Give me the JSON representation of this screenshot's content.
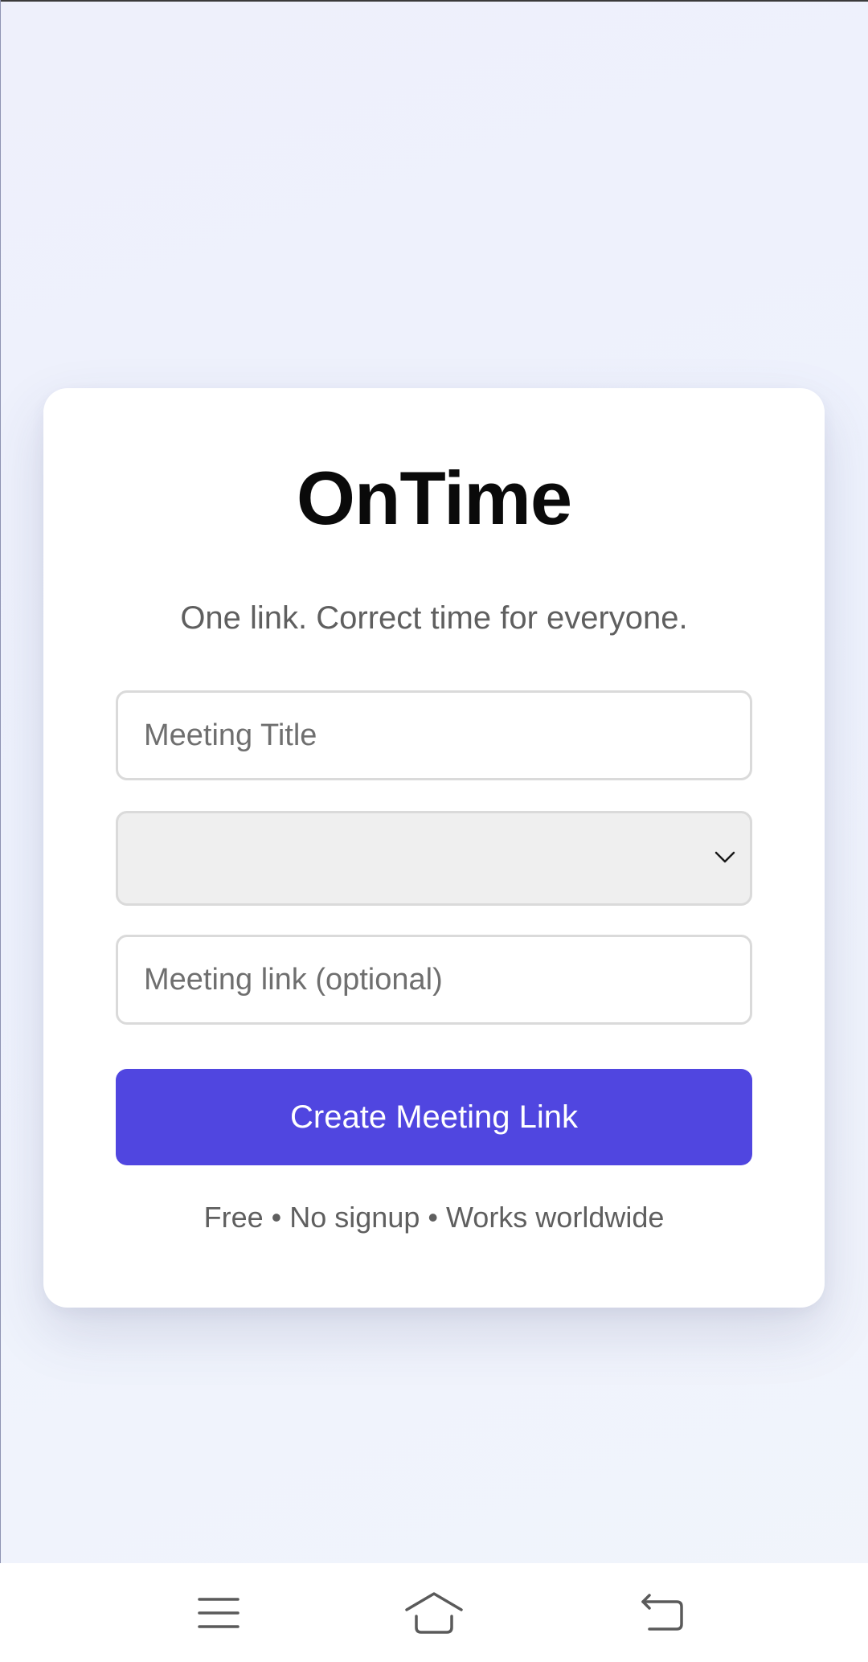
{
  "app": {
    "title": "OnTime",
    "tagline": "One link. Correct time for everyone."
  },
  "form": {
    "title_placeholder": "Meeting Title",
    "timezone_value": "",
    "link_placeholder": "Meeting link (optional)",
    "submit_label": "Create Meeting Link",
    "footnote": "Free • No signup • Works worldwide"
  },
  "theme": {
    "accent": "#5046e0",
    "background": "#eef1fc",
    "card": "#ffffff",
    "select_bg": "#efefef"
  },
  "icons": {
    "select_chevron": "chevron-down-icon",
    "nav_menu": "menu-icon",
    "nav_home": "home-icon",
    "nav_back": "back-icon"
  }
}
